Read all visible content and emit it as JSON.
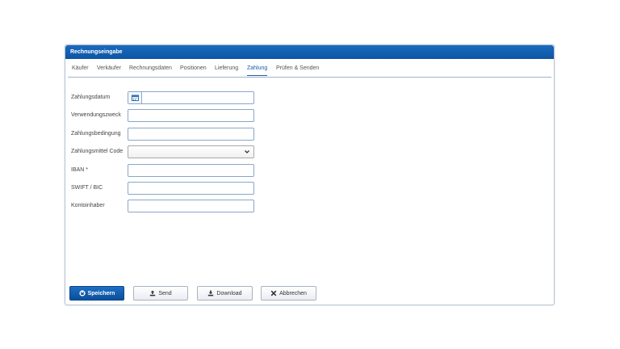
{
  "window": {
    "title": "Rechnungseingabe"
  },
  "tabs": [
    {
      "label": "Käufer"
    },
    {
      "label": "Verkäufer"
    },
    {
      "label": "Rechnungsdaten"
    },
    {
      "label": "Positionen"
    },
    {
      "label": "Lieferung"
    },
    {
      "label": "Zahlung",
      "active": true
    },
    {
      "label": "Prüfen & Senden"
    }
  ],
  "form": {
    "fields": [
      {
        "label": "Zahlungsdatum",
        "type": "date",
        "value": "",
        "icon": "calendar-icon"
      },
      {
        "label": "Verwendungszweck",
        "type": "text",
        "value": ""
      },
      {
        "label": "Zahlungsbedingung",
        "type": "text",
        "value": ""
      },
      {
        "label": "Zahlungsmittel Code",
        "type": "select",
        "value": ""
      },
      {
        "label": "IBAN *",
        "type": "text",
        "value": ""
      },
      {
        "label": "SWIFT / BIC",
        "type": "text",
        "value": ""
      },
      {
        "label": "Kontoinhaber",
        "type": "text",
        "value": ""
      }
    ]
  },
  "footer": {
    "save_label": "Speichern",
    "send_label": "Send",
    "download_label": "Download",
    "cancel_label": "Abbrechen"
  },
  "colors": {
    "titlebar": "#0d55a3",
    "accent": "#1a5ea8",
    "input_border": "#8aa6c8",
    "primary_button": "#0c4f99"
  },
  "icons": {
    "save": "save-icon",
    "send": "upload-icon",
    "download": "download-icon",
    "cancel": "close-icon",
    "select": "chevron-down-icon"
  }
}
